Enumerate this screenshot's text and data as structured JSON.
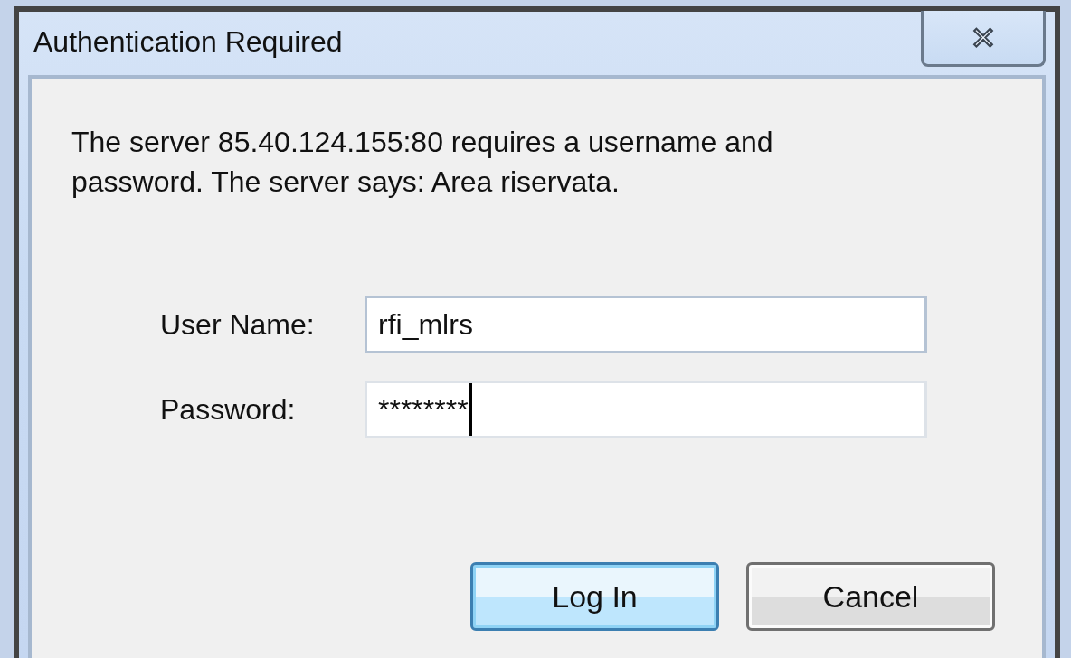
{
  "window": {
    "title": "Authentication Required",
    "close_symbol": "✕"
  },
  "message": "The server 85.40.124.155:80 requires a username and password. The server says: Area riservata.",
  "fields": [
    {
      "label": "User Name:",
      "value": "rfi_mlrs",
      "focused": false
    },
    {
      "label": "Password:",
      "value": "********",
      "focused": true
    }
  ],
  "buttons": [
    {
      "label": "Log In",
      "default": true
    },
    {
      "label": "Cancel",
      "default": false
    }
  ]
}
